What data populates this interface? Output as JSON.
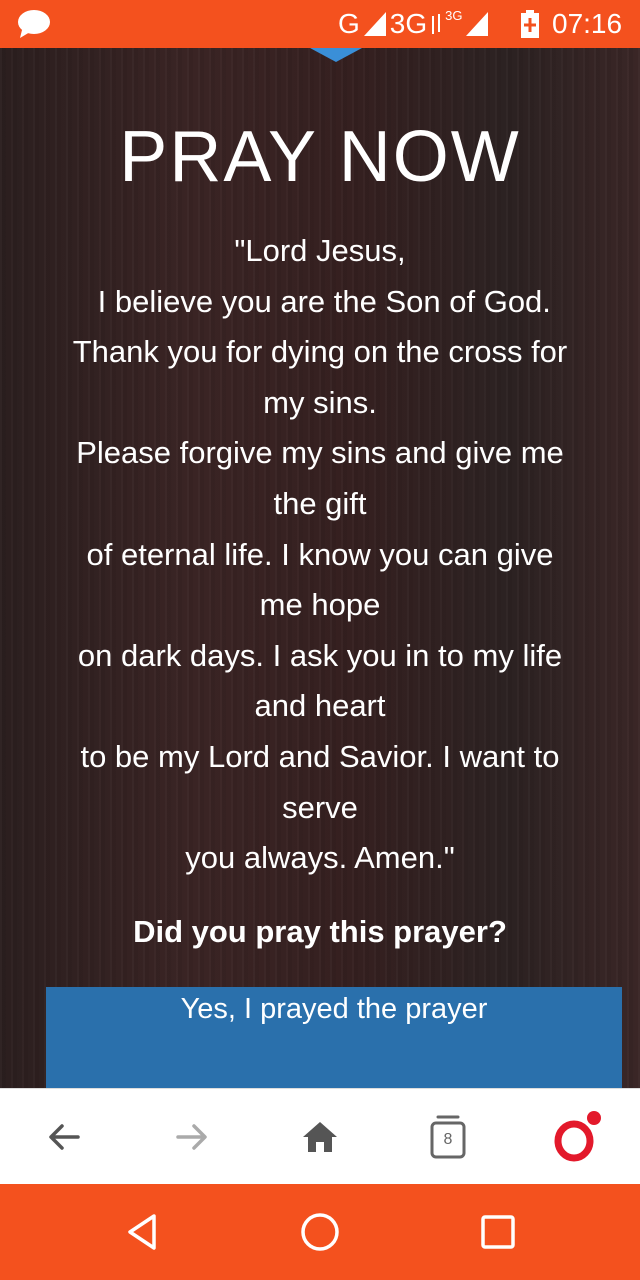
{
  "status_bar": {
    "network_g": "G",
    "network_3g": "3G",
    "network_3g_small": "3G",
    "time": "07:16",
    "icons": [
      "chat-bubble-icon",
      "signal-icon",
      "battery-charging-icon"
    ]
  },
  "page": {
    "title": "PRAY NOW",
    "prayer_lines": [
      "\"Lord Jesus,",
      " I believe you are the Son of God.",
      "Thank you for dying on the cross for",
      "my sins.",
      "Please forgive my sins and give me",
      "the gift",
      "of eternal life. I know you can give",
      "me hope",
      "on dark days. I ask you in to my life",
      "and heart",
      "to be my Lord and Savior. I want to",
      "serve",
      "you always. Amen.\""
    ],
    "question": "Did you pray this prayer?",
    "yes_button_label": "Yes, I prayed the prayer"
  },
  "browser_bar": {
    "tabs_count": "8",
    "icons": [
      "back-arrow-icon",
      "forward-arrow-icon",
      "home-icon",
      "tabs-icon",
      "opera-icon"
    ]
  },
  "colors": {
    "accent": "#F4511E",
    "button_blue": "#2a70ac",
    "notch_blue": "#3a8fd8"
  }
}
